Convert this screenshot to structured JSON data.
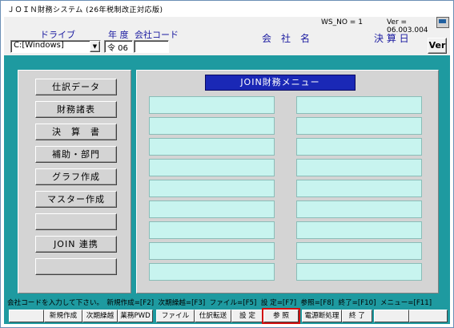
{
  "window": {
    "title": "ＪＯＩＮ財務システム (26年税制改正対応版)"
  },
  "header": {
    "ws_no": "WS_NO = 1",
    "version": "Ver = 06.003.004",
    "drive_label": "ドライブ",
    "drive_value": "C:[Windows]",
    "year_label": "年 度",
    "year_value": "令 06",
    "company_code_label": "会社コード",
    "company_code_value": "",
    "company_label": "会　社　名",
    "fiscal_label": "決 算 日",
    "ver_button": "Ver"
  },
  "left_menu": [
    "仕訳データ",
    "財務諸表",
    "決　算　書",
    "補助・部門",
    "グラフ作成",
    "マスター作成",
    "",
    "JOIN 連携",
    ""
  ],
  "main_menu": {
    "title": "JOIN財務メニュー",
    "left_slots": [
      "",
      "",
      "",
      "",
      "",
      "",
      "",
      "",
      ""
    ],
    "right_slots": [
      "",
      "",
      "",
      "",
      "",
      "",
      "",
      "",
      ""
    ]
  },
  "status_text": "会社コードを入力して下さい。　新規作成=[F2]  次期繰越=[F3]  ファイル=[F5]  設 定=[F7]  参照=[F8]  終了=[F10]  メニュー=[F11]",
  "fkeys": [
    "",
    "新規作成",
    "次期繰越",
    "業務PWD",
    "ファイル",
    "仕訳転送",
    "設 定",
    "参 照",
    "電源断処理",
    "終 了",
    "",
    ""
  ],
  "selected_fkey": "参 照"
}
